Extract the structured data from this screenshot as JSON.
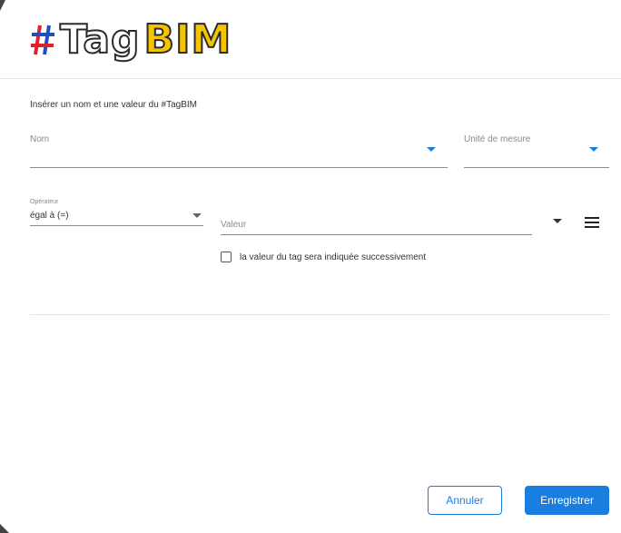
{
  "logo": {
    "hash": "#",
    "tag": "Tag",
    "bim": "BIM"
  },
  "instruction": "Insérer un nom et une valeur du #TagBIM",
  "fields": {
    "nom": {
      "label": "Nom"
    },
    "unite": {
      "label": "Unité de mesure"
    },
    "operateur": {
      "label": "Opérateur",
      "value": "égal à (=)"
    },
    "valeur": {
      "placeholder": "Valeur"
    }
  },
  "checkbox": {
    "label": "la valeur du tag sera indiquée successivement",
    "checked": false
  },
  "buttons": {
    "cancel": "Annuler",
    "save": "Enregistrer"
  },
  "colors": {
    "accent": "#1a7de0",
    "hash_red": "#e2202a",
    "hash_blue": "#1f4fbf",
    "bim_yellow": "#f5c400"
  },
  "icons": {
    "menu": "hamburger-menu-icon",
    "dropdown": "caret-down-icon"
  }
}
